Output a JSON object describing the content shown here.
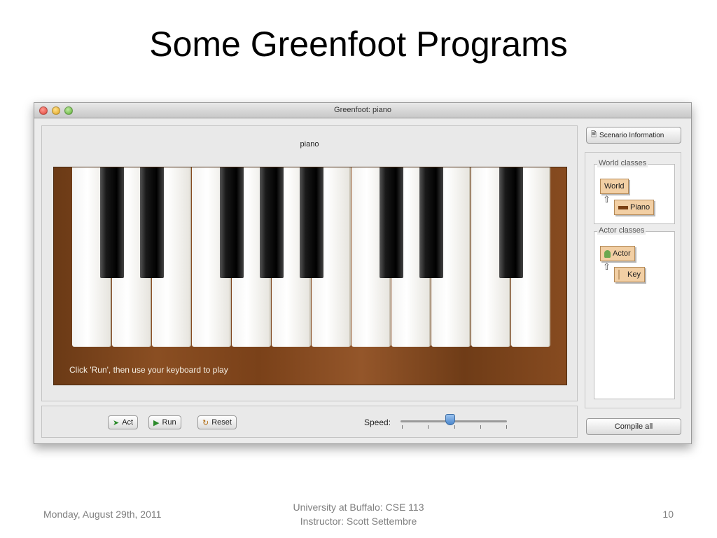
{
  "slide": {
    "title": "Some Greenfoot Programs"
  },
  "window": {
    "title": "Greenfoot: piano",
    "world_name": "piano",
    "piano_hint": "Click 'Run', then use your keyboard to play"
  },
  "controls": {
    "act_label": "Act",
    "run_label": "Run",
    "reset_label": "Reset",
    "speed_label": "Speed:",
    "speed_value_fraction": 0.47
  },
  "sidebar": {
    "scenario_info_label": "Scenario Information",
    "world_classes_label": "World classes",
    "world_classes": [
      "World",
      "Piano"
    ],
    "actor_classes_label": "Actor classes",
    "actor_classes": [
      "Actor",
      "Key"
    ],
    "compile_label": "Compile all"
  },
  "footer": {
    "date": "Monday, August 29th, 2011",
    "line1": "University at Buffalo: CSE 113",
    "line2": "Instructor: Scott Settembre",
    "page": "10"
  },
  "icons": {
    "act": "act-arrow-icon",
    "run": "play-icon",
    "reset": "reset-icon",
    "scenario": "document-icon"
  }
}
